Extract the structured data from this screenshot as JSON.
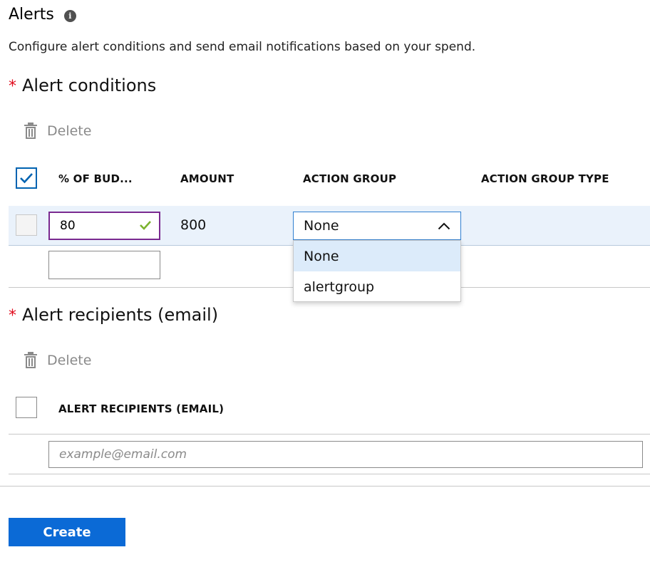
{
  "header": {
    "title": "Alerts",
    "info_icon": "info-icon",
    "description": "Configure alert conditions and send email notifications based on your spend."
  },
  "alert_conditions": {
    "required_mark": "*",
    "title": "Alert conditions",
    "delete_label": "Delete",
    "select_all_checked": true,
    "columns": [
      "% OF BUD...",
      "AMOUNT",
      "ACTION GROUP",
      "ACTION GROUP TYPE"
    ],
    "rows": [
      {
        "checked": false,
        "percent": "80",
        "amount": "800",
        "action_group": "None",
        "action_group_type": ""
      }
    ],
    "new_row_percent": "",
    "action_group_options": [
      "None",
      "alertgroup"
    ],
    "selected_option": "None"
  },
  "alert_recipients": {
    "required_mark": "*",
    "title": "Alert recipients (email)",
    "delete_label": "Delete",
    "column": "ALERT RECIPIENTS (EMAIL)",
    "email_placeholder": "example@email.com"
  },
  "footer": {
    "create_label": "Create"
  },
  "colors": {
    "primary": "#0b6ad6",
    "required": "#e00b1c",
    "valid_check": "#7bb32e",
    "row_selected": "#eaf2fb",
    "input_valid_border": "#7a2a90"
  }
}
